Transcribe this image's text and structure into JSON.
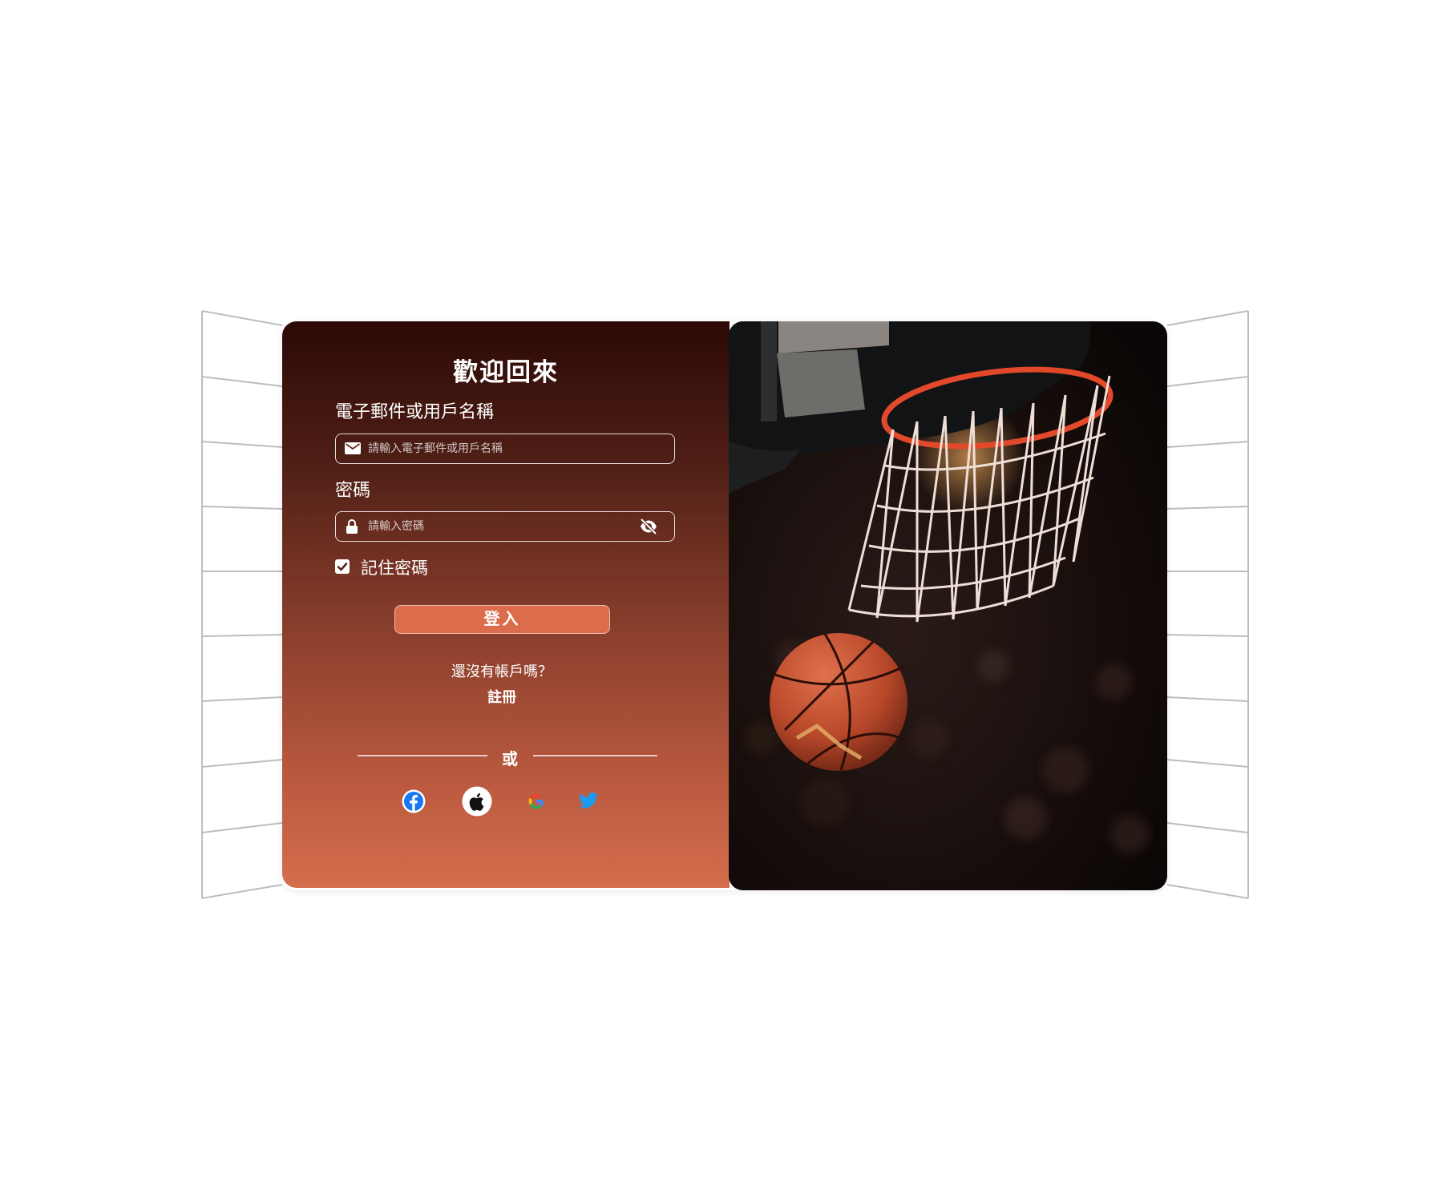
{
  "login": {
    "title": "歡迎回來",
    "email_label": "電子郵件或用戶名稱",
    "email_placeholder": "請輸入電子郵件或用戶名稱",
    "password_label": "密碼",
    "password_placeholder": "請輸入密碼",
    "remember_label": "記住密碼",
    "remember_checked": true,
    "login_button": "登入",
    "no_account_text": "還沒有帳戶嗎？",
    "signup_link": "註冊",
    "or_text": "或"
  },
  "social": [
    {
      "icon": "facebook-icon"
    },
    {
      "icon": "apple-icon"
    },
    {
      "icon": "google-icon"
    },
    {
      "icon": "twitter-icon"
    }
  ],
  "colors": {
    "gradient_top": "#2c0906",
    "gradient_bottom": "#d46e4d",
    "button": "#dc6d4c",
    "rim": "#e2482a",
    "ball": "#c5502f",
    "facebook": "#1877f2",
    "twitter": "#1d9bf0"
  },
  "hero": {
    "image": "basketball-hoop-photo"
  }
}
